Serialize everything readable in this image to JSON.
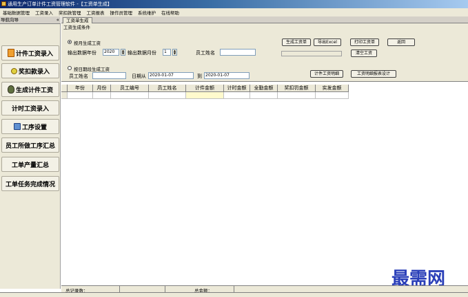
{
  "window": {
    "title": "通用生产订单计件工资管理软件 -【工资单生成】"
  },
  "menu": [
    "基础数据管理",
    "工资录入",
    "奖扣款管理",
    "工资报表",
    "操作员管理",
    "系统维护",
    "在线帮助"
  ],
  "sidebar": {
    "header": "导航向导",
    "pin": "«",
    "items": [
      {
        "label": "计件工资录入",
        "icon": "form-icon"
      },
      {
        "label": "奖扣款录入",
        "icon": "coin-icon"
      },
      {
        "label": "生成计件工资",
        "icon": "money-bag-icon"
      },
      {
        "label": "计时工资录入"
      },
      {
        "label": "工序设置",
        "icon": "settings-icon"
      },
      {
        "label": "员工所做工序汇总"
      },
      {
        "label": "工单产量汇总"
      },
      {
        "label": "工单任务完成情况"
      }
    ]
  },
  "tab": {
    "label": "工资单生成"
  },
  "params": {
    "group_title": "工资生成条件",
    "monthly": {
      "radio_label": "按月生成工资",
      "year_label": "输出数据年份",
      "year_value": "2020",
      "month_label": "输出数据月份",
      "month_value": "1",
      "name_label": "员工姓名",
      "name_value": ""
    },
    "daterange": {
      "radio_label": "按日期段生成工资",
      "name_label": "员工姓名",
      "name_value": "",
      "from_label": "日期从",
      "from_value": "2020-01-07",
      "to_label": "到",
      "to_value": "2020-01-07"
    },
    "buttons": {
      "generate": "生成工资单",
      "export": "导出Excel",
      "print": "打印工资单",
      "back": "返回",
      "clear": "清空工资",
      "detail": "计件工资明细",
      "design": "工资明细报表设计"
    }
  },
  "grid": {
    "columns": [
      "年份",
      "月份",
      "员工编号",
      "员工姓名",
      "计件金额",
      "计时金额",
      "全勤金额",
      "奖扣罚金额",
      "实发金额"
    ]
  },
  "status": {
    "total_records_label": "总记录数：",
    "total_amount_label": "总金额："
  },
  "watermark": "最需网"
}
